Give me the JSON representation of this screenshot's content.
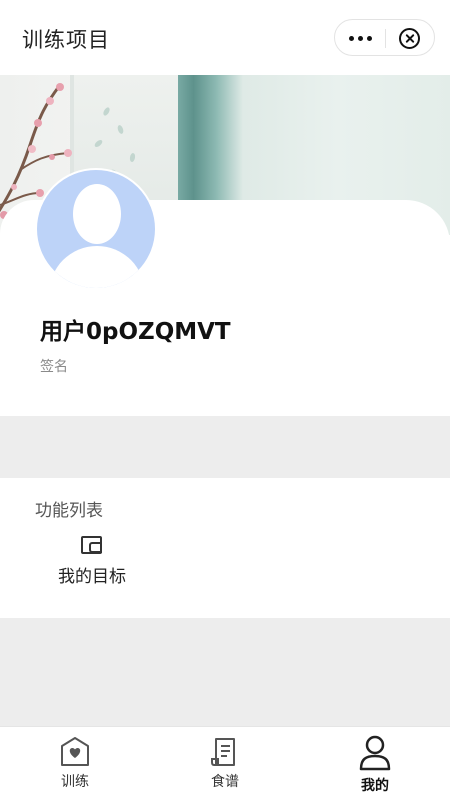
{
  "nav": {
    "title": "训练项目",
    "more_icon": "more-dots-icon",
    "close_icon": "close-circle-icon"
  },
  "profile": {
    "username": "用户0pOZQMVT",
    "signature": "签名"
  },
  "features": {
    "title": "功能列表",
    "items": [
      {
        "label": "我的目标",
        "icon": "wallet-icon"
      }
    ]
  },
  "tabbar": {
    "tabs": [
      {
        "label": "训练",
        "icon": "heart-shield-icon",
        "active": false
      },
      {
        "label": "食谱",
        "icon": "recipe-scroll-icon",
        "active": false
      },
      {
        "label": "我的",
        "icon": "user-icon",
        "active": true
      }
    ]
  },
  "colors": {
    "avatar_bg": "#bdd3f8",
    "section_gap": "#ededed",
    "banner_teal": "#5e928c"
  }
}
